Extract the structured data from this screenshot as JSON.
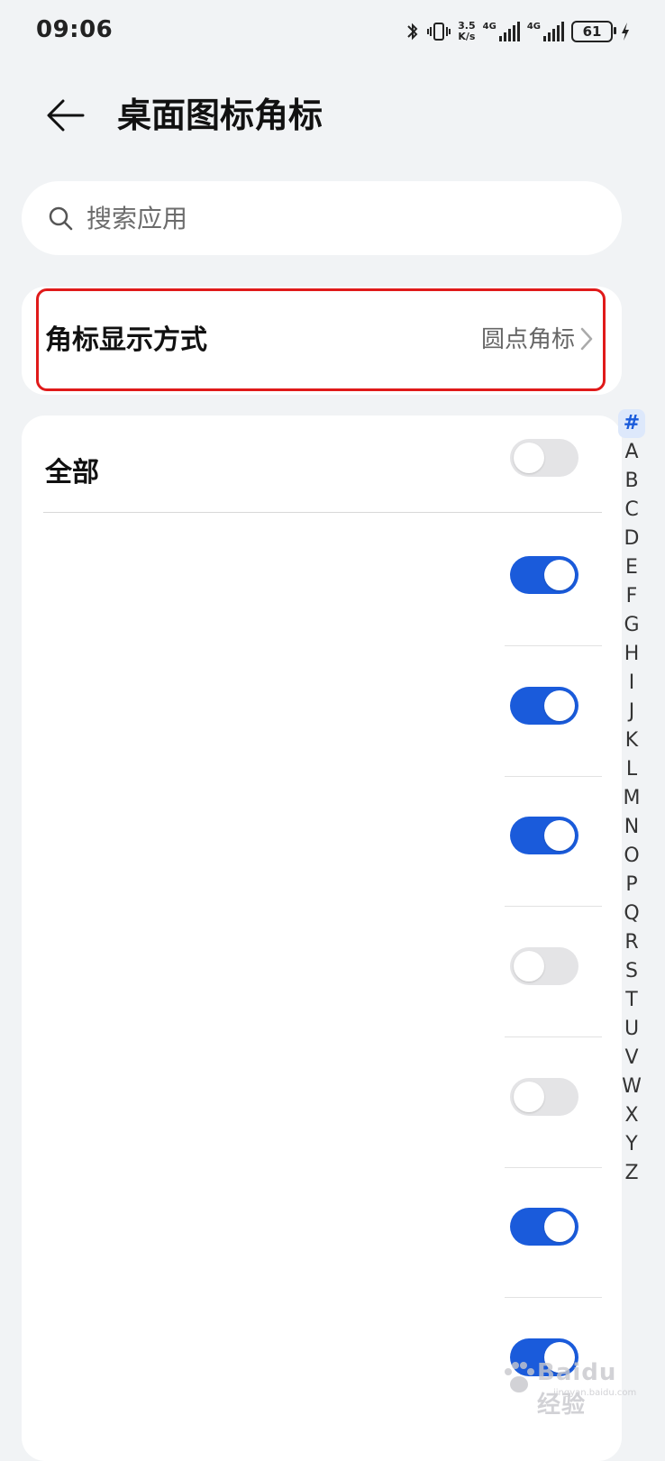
{
  "status_bar": {
    "time": "09:06",
    "net_speed_value": "3.5",
    "net_speed_unit": "K/s",
    "signal1_label": "4G",
    "signal2_label": "4G",
    "battery": "61"
  },
  "header": {
    "title": "桌面图标角标"
  },
  "search": {
    "placeholder": "搜索应用"
  },
  "badge_style": {
    "label": "角标显示方式",
    "value": "圆点角标"
  },
  "list": {
    "all_label": "全部",
    "all_toggle": "off",
    "rows": [
      {
        "toggle": "on"
      },
      {
        "toggle": "on"
      },
      {
        "toggle": "on"
      },
      {
        "toggle": "off"
      },
      {
        "toggle": "off"
      },
      {
        "toggle": "on"
      },
      {
        "toggle": "on"
      }
    ]
  },
  "index_bar": [
    "#",
    "A",
    "B",
    "C",
    "D",
    "E",
    "F",
    "G",
    "H",
    "I",
    "J",
    "K",
    "L",
    "M",
    "N",
    "O",
    "P",
    "Q",
    "R",
    "S",
    "T",
    "U",
    "V",
    "W",
    "X",
    "Y",
    "Z"
  ],
  "index_active": "#",
  "watermark": {
    "text": "Baidu经验",
    "sub": "jingyan.baidu.com"
  },
  "colors": {
    "accent": "#1a5bdb",
    "highlight": "#e01a1a",
    "background": "#f1f3f5"
  }
}
